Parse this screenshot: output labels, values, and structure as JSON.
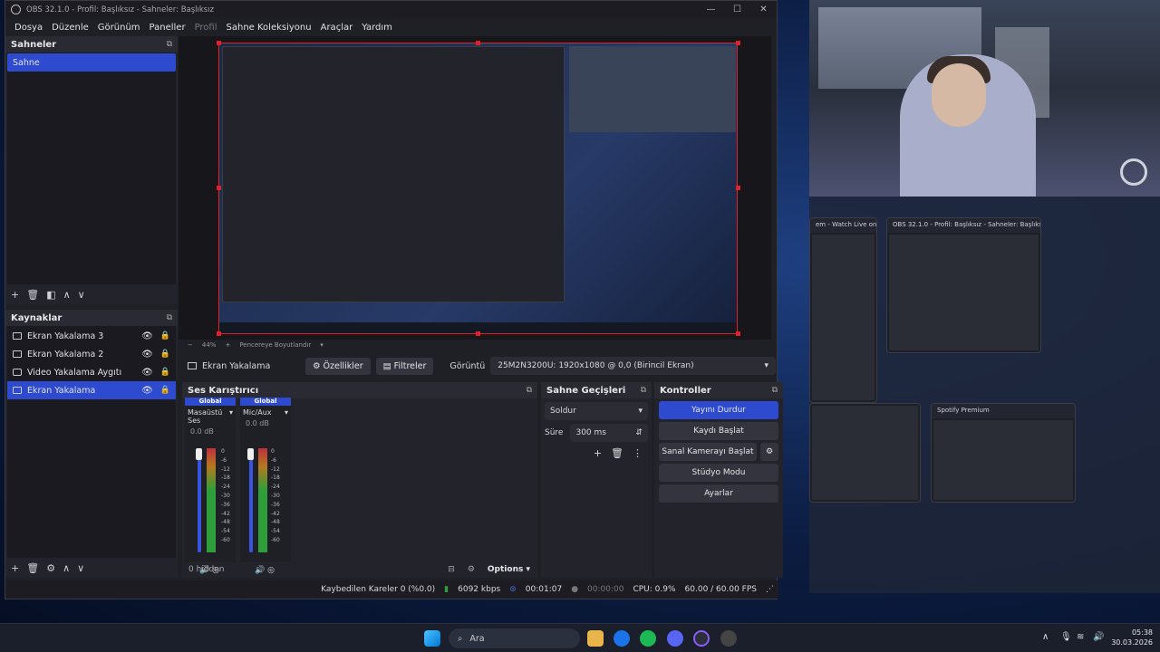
{
  "window_title": "OBS 32.1.0 - Profil: Başlıksız - Sahneler: Başlıksız",
  "menu": [
    "Dosya",
    "Düzenle",
    "Görünüm",
    "Paneller",
    "Profil",
    "Sahne Koleksiyonu",
    "Araçlar",
    "Yardım"
  ],
  "scenes": {
    "title": "Sahneler",
    "items": [
      "Sahne"
    ]
  },
  "sources": {
    "title": "Kaynaklar",
    "items": [
      "Ekran Yakalama 3",
      "Ekran Yakalama 2",
      "Video Yakalama Aygıtı",
      "Ekran Yakalama"
    ]
  },
  "preview": {
    "zoom": "44%",
    "fit_label": "Pencereye Boyutlandır"
  },
  "source_bar": {
    "current": "Ekran Yakalama",
    "properties": "Özellikler",
    "filters": "Filtreler",
    "display_label": "Görüntü",
    "display_value": "25M2N3200U: 1920x1080 @ 0,0 (Birincil Ekran)"
  },
  "mixer": {
    "title": "Ses Karıştırıcı",
    "channels": [
      {
        "global": "Global",
        "name": "Masaüstü Ses",
        "db": "0.0 dB"
      },
      {
        "global": "Global",
        "name": "Mic/Aux",
        "db": "0.0 dB"
      }
    ],
    "ticks": [
      "0",
      "-6",
      "-12",
      "-18",
      "-24",
      "-30",
      "-36",
      "-42",
      "-48",
      "-54",
      "-60"
    ],
    "hidden": "0 hidden",
    "options": "Options"
  },
  "transitions": {
    "title": "Sahne Geçişleri",
    "type": "Soldur",
    "duration_label": "Süre",
    "duration": "300 ms"
  },
  "controls": {
    "title": "Kontroller",
    "buttons": [
      "Yayını Durdur",
      "Kaydı Başlat",
      "Sanal Kamerayı Başlat",
      "Stüdyo Modu",
      "Ayarlar"
    ]
  },
  "status": {
    "dropped": "Kaybedilen Kareler 0 (%0.0)",
    "bitrate": "6092 kbps",
    "stream_time": "00:01:07",
    "rec_time": "00:00:00",
    "cpu": "CPU: 0.9%",
    "fps": "60.00 / 60.00 FPS"
  },
  "task_view": {
    "thumb1": "OBS 32.1.0 - Profil: Başlıksız - Sahneler: Başlıksız",
    "thumb2": "Spotify Premium",
    "thumb0": "em - Watch Live on Kick - G..."
  },
  "taskbar": {
    "search": "Ara",
    "time": "05:38",
    "date": "30.03.2026"
  }
}
